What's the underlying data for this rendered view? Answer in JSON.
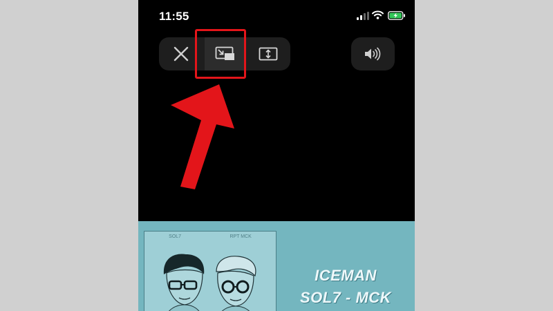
{
  "status_bar": {
    "time": "11:55",
    "icons": [
      "cellular-signal-icon",
      "wifi-icon",
      "battery-charging-icon"
    ]
  },
  "player_controls": {
    "buttons": [
      "close-icon",
      "picture-in-picture-icon",
      "fill-screen-icon"
    ],
    "volume": "speaker-volume-icon"
  },
  "annotation": {
    "highlighted_control": "picture-in-picture-icon",
    "color": "#e3151a"
  },
  "video": {
    "title": "ICEMAN",
    "artists": "SOL7 - MCK",
    "cover_labels": [
      "SOL7",
      "RPT MCK"
    ]
  },
  "colors": {
    "background": "#000000",
    "page_margin": "#d0d0d0",
    "video_bg": "#74b6bf",
    "battery_charge": "#34c759"
  }
}
